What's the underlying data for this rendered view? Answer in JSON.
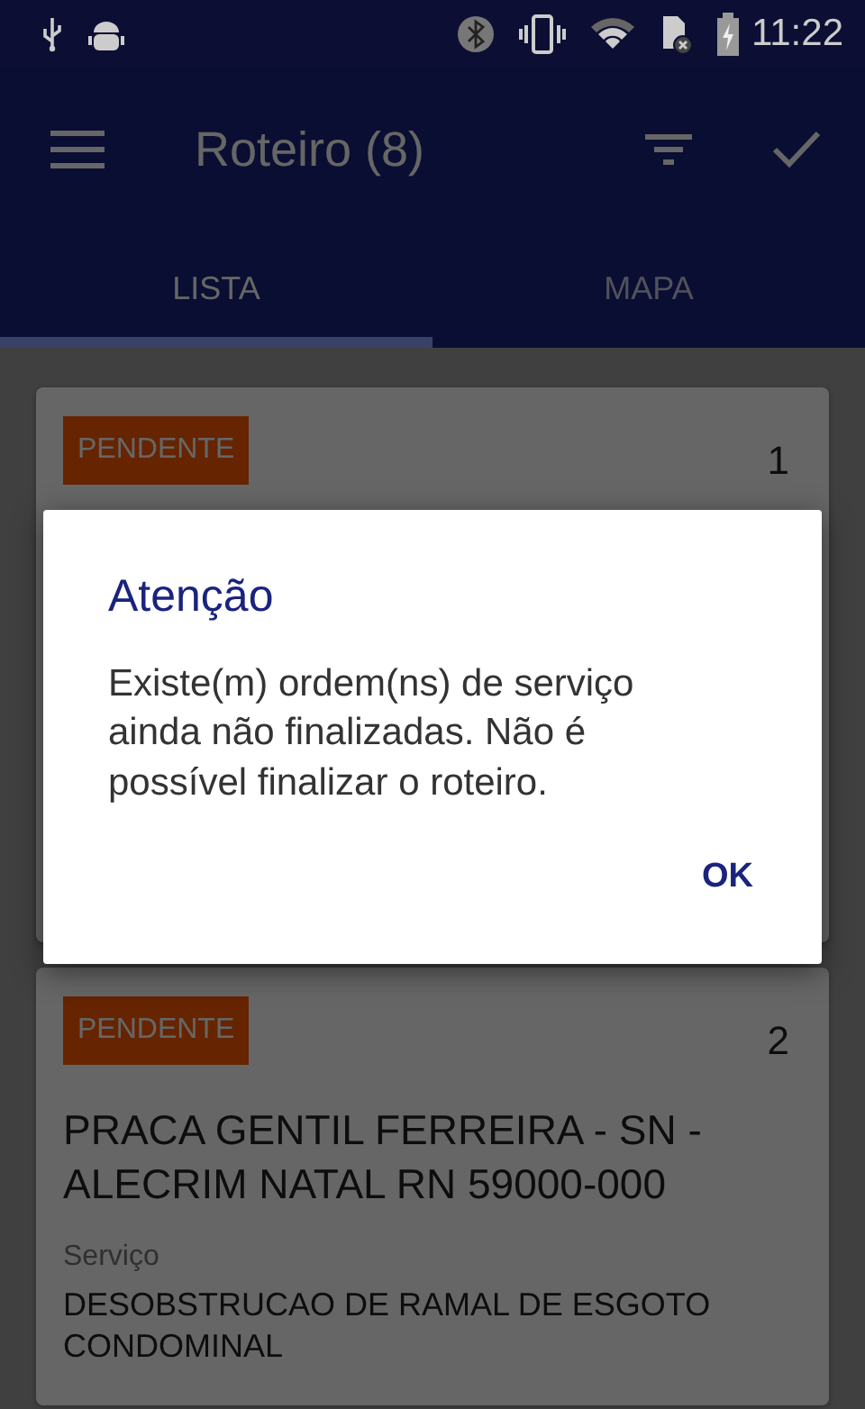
{
  "status_bar": {
    "time": "11:22"
  },
  "toolbar": {
    "title": "Roteiro (8)"
  },
  "tabs": [
    {
      "label": "LISTA",
      "selected": true
    },
    {
      "label": "MAPA",
      "selected": false
    }
  ],
  "cards": [
    {
      "status": "PENDENTE",
      "number": "1"
    },
    {
      "status": "PENDENTE",
      "number": "2",
      "address": "PRACA GENTIL FERREIRA - SN - ALECRIM NATAL RN 59000-000",
      "service_label": "Serviço",
      "service": "DESOBSTRUCAO DE RAMAL DE ESGOTO CONDOMINAL"
    }
  ],
  "dialog": {
    "title": "Atenção",
    "message": "Existe(m) ordem(ns) de serviço ainda não finalizadas. Não é possível finalizar o roteiro.",
    "button": "OK"
  }
}
